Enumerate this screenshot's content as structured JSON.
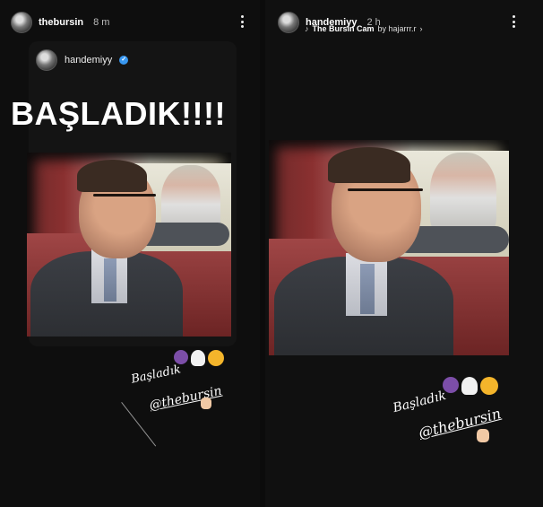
{
  "left_story": {
    "username": "thebursin",
    "time": "8 m",
    "reshare": {
      "username": "handemiyy"
    },
    "title": "BAŞLADIK!!!!",
    "caption": "Başladık",
    "mention": "@thebursin"
  },
  "right_story": {
    "username": "handemiyy",
    "time": "2 h",
    "music": {
      "title": "The Bursin Cam",
      "artist": "by hajarrr.r",
      "chevron": "›"
    },
    "caption": "Başladık",
    "mention": "@thebursin"
  },
  "icons": {
    "music_icon": "♪",
    "verified_mark": "✓",
    "emoji_person": "🙆",
    "emoji_ghost": "👻",
    "emoji_smile": "🥰",
    "emoji_hand": "🤟"
  }
}
